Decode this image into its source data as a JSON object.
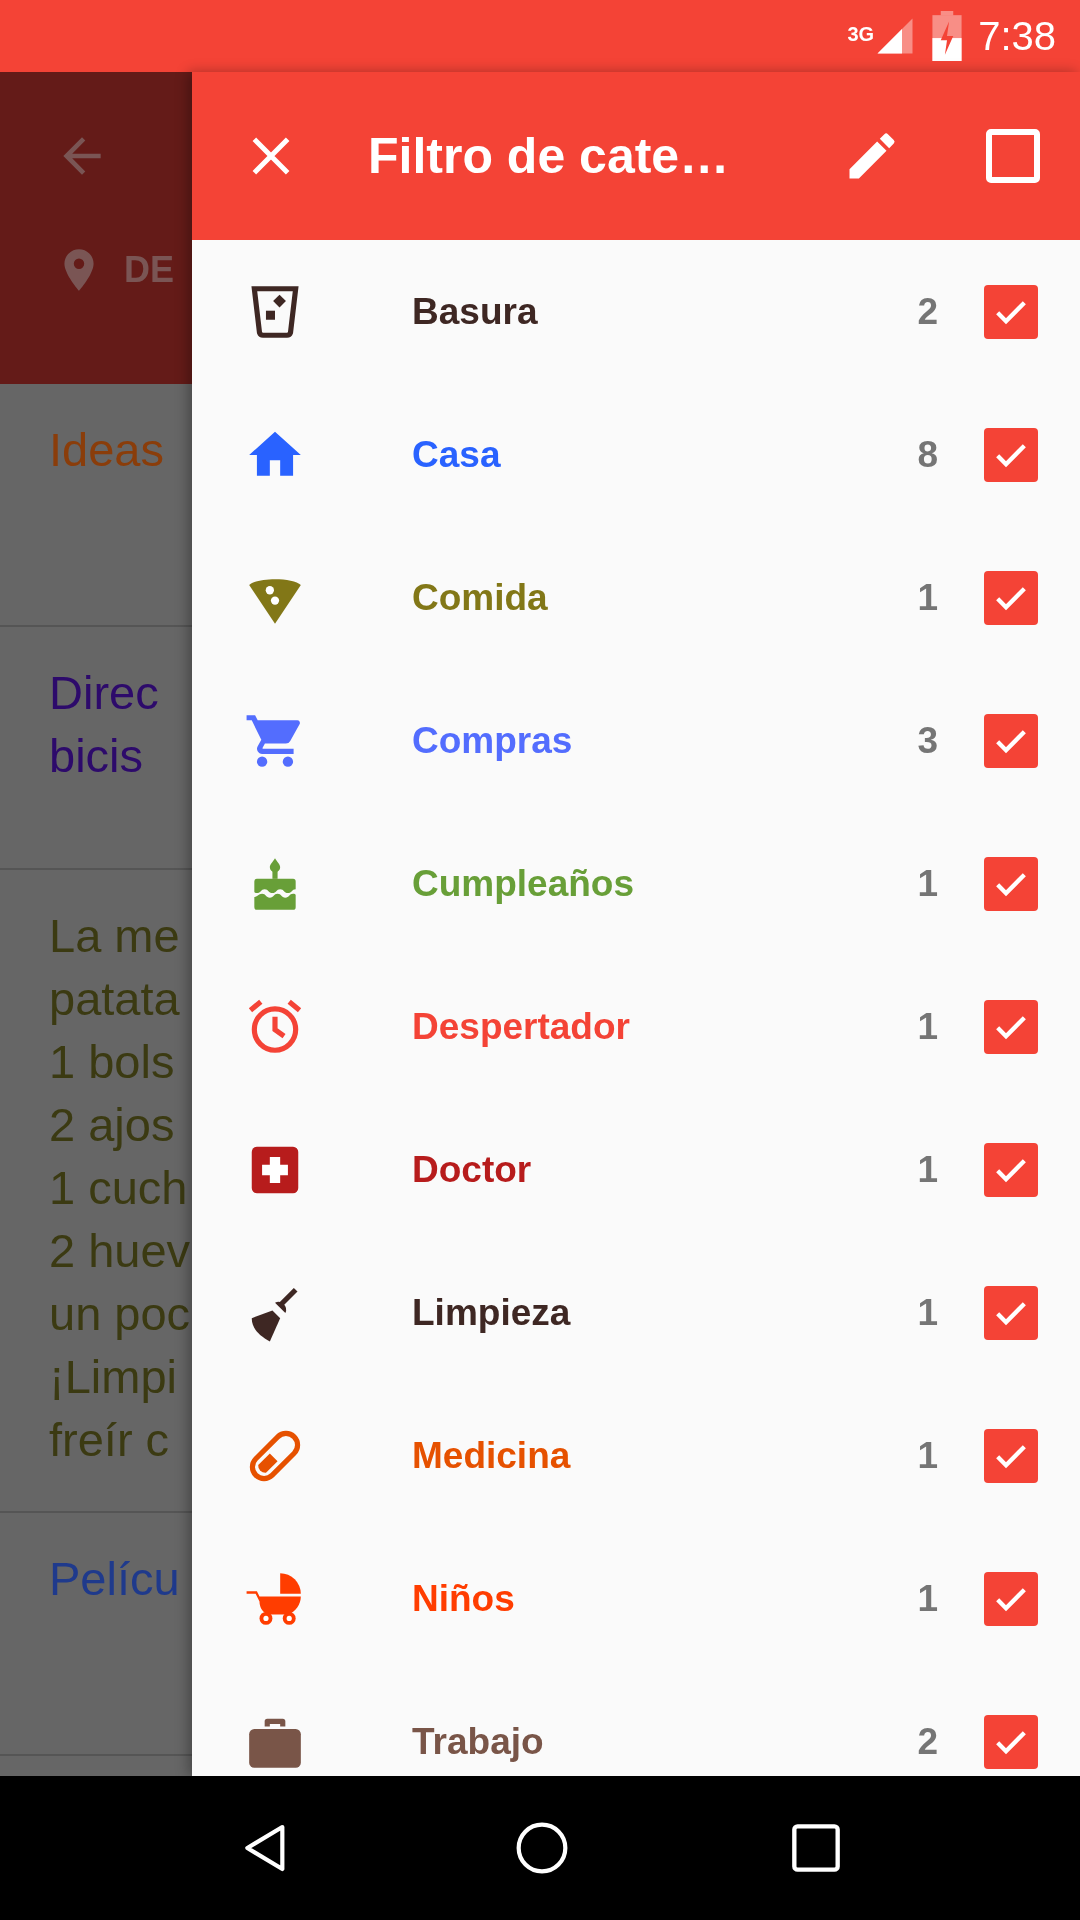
{
  "status_bar": {
    "network": "3G",
    "time": "7:38"
  },
  "background": {
    "toolbar_label": "DE",
    "notes": [
      {
        "lines": [
          "Ideas"
        ],
        "color": "#8a3d0a"
      },
      {
        "lines": [
          "Direc",
          "bicis"
        ],
        "color": "#2d0a6b"
      },
      {
        "lines": [
          "La me",
          "patata",
          "1 bols",
          "2 ajos",
          "1 cuch",
          "2 huev",
          "un poc",
          "¡Limpi",
          "freír c"
        ],
        "color": "#3b3a12"
      },
      {
        "lines": [
          "Pelícu"
        ],
        "color": "#1f3a8c"
      }
    ]
  },
  "drawer": {
    "title": "Filtro de cate…",
    "select_all": {
      "checked": false
    },
    "categories": [
      {
        "name": "Basura",
        "count": "2",
        "checked": true,
        "color": "#3e2723"
      },
      {
        "name": "Casa",
        "count": "8",
        "checked": true,
        "color": "#2962ff"
      },
      {
        "name": "Comida",
        "count": "1",
        "checked": true,
        "color": "#827717"
      },
      {
        "name": "Compras",
        "count": "3",
        "checked": true,
        "color": "#536dfe"
      },
      {
        "name": "Cumpleaños",
        "count": "1",
        "checked": true,
        "color": "#689f38"
      },
      {
        "name": "Despertador",
        "count": "1",
        "checked": true,
        "color": "#f44336"
      },
      {
        "name": "Doctor",
        "count": "1",
        "checked": true,
        "color": "#b71c1c"
      },
      {
        "name": "Limpieza",
        "count": "1",
        "checked": true,
        "color": "#3e2723"
      },
      {
        "name": "Medicina",
        "count": "1",
        "checked": true,
        "color": "#e65100"
      },
      {
        "name": "Niños",
        "count": "1",
        "checked": true,
        "color": "#ff3d00"
      },
      {
        "name": "Trabajo",
        "count": "2",
        "checked": true,
        "color": "#795548"
      }
    ]
  }
}
